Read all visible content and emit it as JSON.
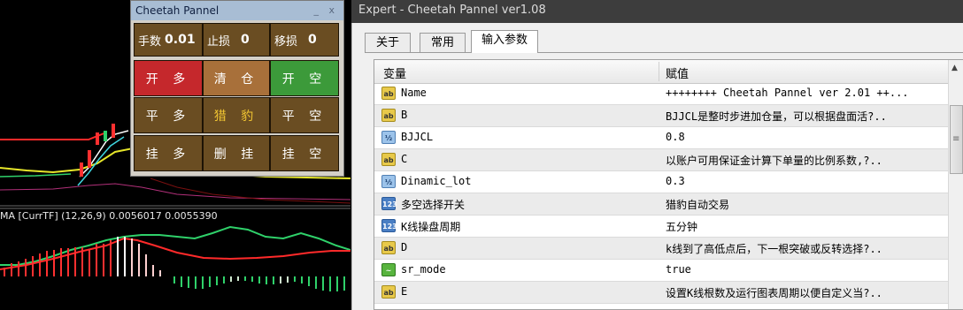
{
  "chart": {
    "macd_label": "MA [CurrTF] (12,26,9) 0.0056017 0.0055390"
  },
  "panel": {
    "title": "Cheetah Pannel",
    "title_controls": "_ x",
    "info": [
      {
        "label": "手数",
        "value": "0.01"
      },
      {
        "label": "止损",
        "value": "0"
      },
      {
        "label": "移损",
        "value": "0"
      }
    ],
    "buttons": [
      [
        "开 多",
        "清 仓",
        "开 空"
      ],
      [
        "平 多",
        "猎 豹",
        "平 空"
      ],
      [
        "挂 多",
        "删 挂",
        "挂 空"
      ]
    ]
  },
  "expert": {
    "title": "Expert - Cheetah Pannel ver1.08",
    "tabs": [
      "关于",
      "常用",
      "输入参数"
    ],
    "active_tab": "输入参数",
    "columns": [
      "变量",
      "赋值"
    ],
    "rows": [
      {
        "icon": "ab",
        "name": "Name",
        "value": "++++++++ Cheetah Pannel ver 2.01 ++..."
      },
      {
        "icon": "ab",
        "name": "B",
        "value": "BJJCL是整时步进加仓量，可以根据盘面活?.."
      },
      {
        "icon": "half",
        "name": "BJJCL",
        "value": "0.8"
      },
      {
        "icon": "ab",
        "name": "C",
        "value": "以账户可用保证金计算下单量的比例系数,?.."
      },
      {
        "icon": "half",
        "name": "Dinamic_lot",
        "value": "0.3"
      },
      {
        "icon": "num",
        "name": "多空选择开关",
        "value": "猎豹自动交易"
      },
      {
        "icon": "num",
        "name": "K线操盘周期",
        "value": "五分钟"
      },
      {
        "icon": "ab",
        "name": "D",
        "value": "k线到了高低点后，下一根突破或反转选择?.."
      },
      {
        "icon": "bool",
        "name": "sr_mode",
        "value": "true"
      },
      {
        "icon": "ab",
        "name": "E",
        "value": "设置K线根数及运行图表周期以便自定义当?.."
      }
    ],
    "icon_text": {
      "ab": "ab",
      "half": "½",
      "num": "123",
      "bool": "~"
    }
  },
  "colors": {
    "panel_brown": "#6a4d22",
    "open_long_red": "#c5282c",
    "close_all_orange": "#a8703a",
    "open_short_green": "#3c9a3a",
    "cheetah_gold": "#f2c632"
  }
}
